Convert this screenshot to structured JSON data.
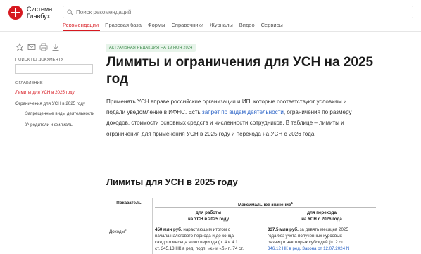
{
  "header": {
    "logo": {
      "line1": "Система",
      "line2": "Главбух"
    },
    "search": {
      "placeholder": "Поиск рекомендаций"
    },
    "nav": [
      "Рекомендации",
      "Правовая база",
      "Формы",
      "Справочники",
      "Журналы",
      "Видео",
      "Сервисы"
    ]
  },
  "sidebar": {
    "search_label": "ПОИСК ПО ДОКУМЕНТУ",
    "toc_label": "ОГЛАВЛЕНИЕ",
    "toc": [
      "Лимиты для УСН в 2025 году",
      "Ограничения для УСН в 2025 году",
      "Запрещенные виды деятельности",
      "Учредители и филиалы"
    ]
  },
  "main": {
    "badge": "АКТУАЛЬНАЯ РЕДАКЦИЯ НА 19 НОЯ 2024",
    "title": "Лимиты и ограничения для УСН на 2025 год",
    "intro_part1": "Применять УСН вправе российские организации и ИП, которые соответствуют условиям и подали уведомление в ИФНС. Есть ",
    "intro_link": "запрет по видам деятельности",
    "intro_part2": ", ограничения по размеру доходов, стоимости основных средств и численности сотрудников. В таблице – лимиты и ограничения для применения УСН в 2025 году и перехода на УСН с 2026 года.",
    "section_title": "Лимиты для УСН в 2025 году"
  },
  "table": {
    "col_indicator": "Показатель",
    "col_max": "Максимальное значение",
    "col_max_sup": "1",
    "sub_work_line1": "для работы",
    "sub_work_line2": "на УСН в 2025 году",
    "sub_switch_line1": "для перехода",
    "sub_switch_line2": "на УСН с 2026 года",
    "row1_label": "Доходы",
    "row1_label_sup": "5",
    "row1_c1_bold": "450 млн руб.",
    "row1_c1_l1": " нарастающим итогом с",
    "row1_c1_l2": "начала налогового периода и до конца",
    "row1_c1_l3": "каждого месяца этого периода",
    "row1_c1_l3_tail": " (п. 4 и 4.1",
    "row1_c1_l4": "ст. 345.13 НК в ред. подп. «к» и «б» п. 74 ст.",
    "row1_c2_bold": "337,5 млн руб.",
    "row1_c2_l1": " за девять месяцев 2025",
    "row1_c2_l2": "года без учета полученных курсовых",
    "row1_c2_l3": "разниц и некоторых субсидий",
    "row1_c2_l3_tail": " (п. 2 ст.",
    "row1_c2_l4": "346.12 НК в ред. Закона от 12.07.2024 N"
  }
}
